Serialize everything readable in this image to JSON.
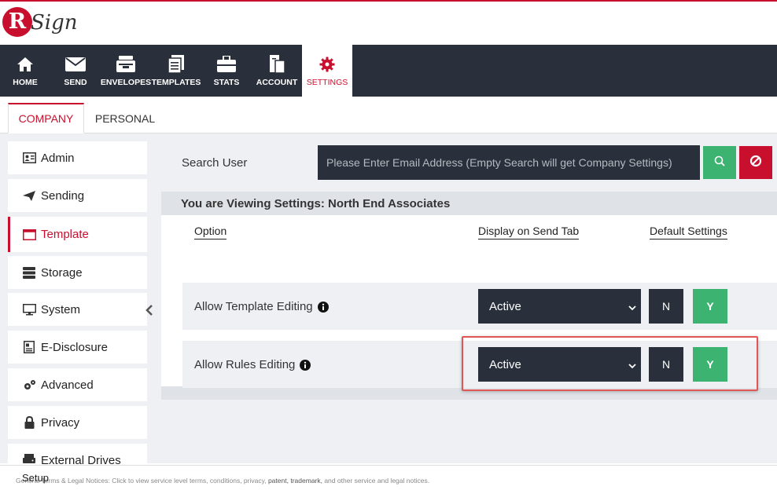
{
  "brand": {
    "logo_letter": "R",
    "logo_text": "Sign",
    "accent": "#c8102e",
    "dark": "#2a303b",
    "green": "#3cb371"
  },
  "nav": {
    "items": [
      {
        "label": "HOME",
        "icon": "home-icon"
      },
      {
        "label": "SEND",
        "icon": "envelope-icon"
      },
      {
        "label": "ENVELOPES",
        "icon": "inbox-icon"
      },
      {
        "label": "TEMPLATES",
        "icon": "documents-icon"
      },
      {
        "label": "STATS",
        "icon": "briefcase-icon"
      },
      {
        "label": "ACCOUNT",
        "icon": "account-icon"
      },
      {
        "label": "SETTINGS",
        "icon": "gear-icon",
        "active": true
      }
    ]
  },
  "subtabs": [
    {
      "label": "COMPANY",
      "active": true
    },
    {
      "label": "PERSONAL"
    }
  ],
  "sidebar": {
    "items": [
      {
        "label": "Admin",
        "icon": "admin-icon"
      },
      {
        "label": "Sending",
        "icon": "paper-plane-icon"
      },
      {
        "label": "Template",
        "icon": "template-icon",
        "active": true
      },
      {
        "label": "Storage",
        "icon": "storage-icon"
      },
      {
        "label": "System",
        "icon": "monitor-icon"
      },
      {
        "label": "E-Disclosure",
        "icon": "disclosure-icon"
      },
      {
        "label": "Advanced",
        "icon": "gears-icon"
      },
      {
        "label": "Privacy",
        "icon": "lock-icon"
      },
      {
        "label": "External Drives",
        "icon": "drive-icon"
      }
    ],
    "overflow_label": "Setup"
  },
  "search": {
    "label": "Search User",
    "placeholder": "Please Enter Email Address (Empty Search will get Company Settings)",
    "value": ""
  },
  "settings": {
    "viewing_text": "You are Viewing Settings: North End Associates",
    "columns": {
      "option": "Option",
      "display": "Display on Send Tab",
      "default": "Default Settings"
    },
    "rows": [
      {
        "label": "Allow Template Editing",
        "display_value": "Active",
        "n_label": "N",
        "y_label": "Y",
        "selected": "Y"
      },
      {
        "label": "Allow Rules Editing",
        "display_value": "Active",
        "n_label": "N",
        "y_label": "Y",
        "selected": "Y"
      }
    ]
  },
  "footer": {
    "lead": "General Terms & Legal Notices:",
    "text_a": "Click to view service level terms, conditions, privacy,",
    "patent": "patent,",
    "trademark": "trademark,",
    "text_b": "and other service and legal notices."
  }
}
